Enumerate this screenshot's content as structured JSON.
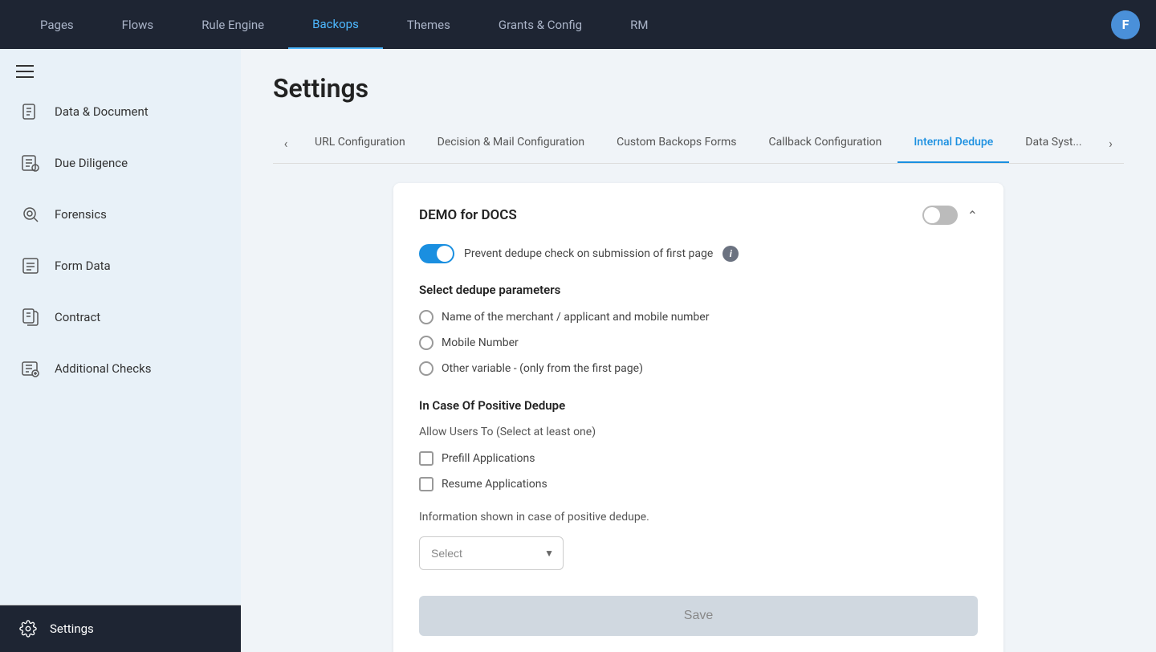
{
  "topNav": {
    "items": [
      {
        "id": "pages",
        "label": "Pages",
        "active": false
      },
      {
        "id": "flows",
        "label": "Flows",
        "active": false
      },
      {
        "id": "rule-engine",
        "label": "Rule Engine",
        "active": false
      },
      {
        "id": "backops",
        "label": "Backops",
        "active": true
      },
      {
        "id": "themes",
        "label": "Themes",
        "active": false
      },
      {
        "id": "grants-config",
        "label": "Grants & Config",
        "active": false
      },
      {
        "id": "rm",
        "label": "RM",
        "active": false
      }
    ],
    "avatar": "F"
  },
  "sidebar": {
    "items": [
      {
        "id": "data-document",
        "label": "Data & Document"
      },
      {
        "id": "due-diligence",
        "label": "Due Diligence"
      },
      {
        "id": "forensics",
        "label": "Forensics"
      },
      {
        "id": "form-data",
        "label": "Form Data"
      },
      {
        "id": "contract",
        "label": "Contract"
      },
      {
        "id": "additional-checks",
        "label": "Additional Checks"
      }
    ],
    "settings": {
      "label": "Settings"
    }
  },
  "page": {
    "title": "Settings"
  },
  "tabs": [
    {
      "id": "url-config",
      "label": "URL Configuration",
      "active": false
    },
    {
      "id": "decision-mail",
      "label": "Decision & Mail Configuration",
      "active": false
    },
    {
      "id": "custom-backops",
      "label": "Custom Backops Forms",
      "active": false
    },
    {
      "id": "callback",
      "label": "Callback Configuration",
      "active": false
    },
    {
      "id": "internal-dedupe",
      "label": "Internal Dedupe",
      "active": true
    },
    {
      "id": "data-syst",
      "label": "Data Syst...",
      "active": false
    }
  ],
  "card": {
    "title": "DEMO for DOCS",
    "toggle_state": "off",
    "prevent_dedupe_label": "Prevent dedupe check on submission of first page",
    "prevent_toggle_state": "on",
    "section1_title": "Select dedupe parameters",
    "radio_options": [
      {
        "id": "radio-name-mobile",
        "label": "Name of the merchant / applicant and mobile number"
      },
      {
        "id": "radio-mobile",
        "label": "Mobile Number"
      },
      {
        "id": "radio-other",
        "label": "Other variable - (only from the first page)"
      }
    ],
    "section2_title": "In Case Of Positive Dedupe",
    "allow_users_label": "Allow Users To (Select at least one)",
    "checkboxes": [
      {
        "id": "cb-prefill",
        "label": "Prefill Applications",
        "checked": false
      },
      {
        "id": "cb-resume",
        "label": "Resume Applications",
        "checked": false
      }
    ],
    "info_text": "Information shown in case of positive dedupe.",
    "select_placeholder": "Select",
    "save_label": "Save"
  }
}
